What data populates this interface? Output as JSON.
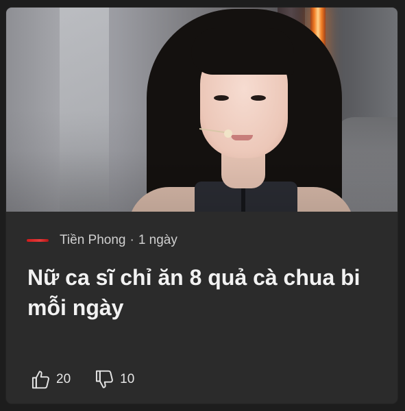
{
  "article": {
    "image_alt": "Nữ ca sĩ",
    "source": {
      "name": "Tiền Phong",
      "separator": "·",
      "age": "1 ngày",
      "logo_color": "#d21a1a"
    },
    "headline": "Nữ ca sĩ chỉ ăn 8 quả cà chua bi mỗi ngày"
  },
  "reactions": {
    "like": {
      "icon": "thumbs-up-icon",
      "count": "20"
    },
    "dislike": {
      "icon": "thumbs-down-icon",
      "count": "10"
    }
  },
  "theme": {
    "card_bg": "#2b2b2b",
    "page_bg": "#1d1d1d",
    "text": "#f2f2f2",
    "muted": "#d0d0d0"
  }
}
